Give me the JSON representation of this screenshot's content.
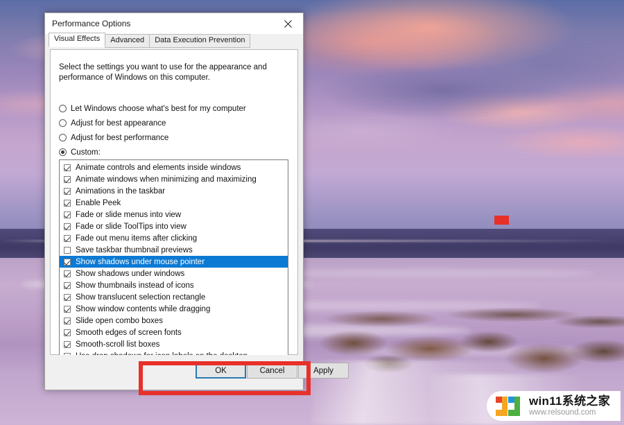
{
  "dialog": {
    "title": "Performance Options",
    "close_icon": "close-icon",
    "tabs": [
      {
        "label": "Visual Effects",
        "active": true
      },
      {
        "label": "Advanced",
        "active": false
      },
      {
        "label": "Data Execution Prevention",
        "active": false
      }
    ],
    "description": "Select the settings you want to use for the appearance and performance of Windows on this computer.",
    "radio_options": [
      {
        "label": "Let Windows choose what's best for my computer",
        "selected": false
      },
      {
        "label": "Adjust for best appearance",
        "selected": false
      },
      {
        "label": "Adjust for best performance",
        "selected": false
      },
      {
        "label": "Custom:",
        "selected": true
      }
    ],
    "checkbox_items": [
      {
        "label": "Animate controls and elements inside windows",
        "checked": true,
        "selected": false
      },
      {
        "label": "Animate windows when minimizing and maximizing",
        "checked": true,
        "selected": false
      },
      {
        "label": "Animations in the taskbar",
        "checked": true,
        "selected": false
      },
      {
        "label": "Enable Peek",
        "checked": true,
        "selected": false
      },
      {
        "label": "Fade or slide menus into view",
        "checked": true,
        "selected": false
      },
      {
        "label": "Fade or slide ToolTips into view",
        "checked": true,
        "selected": false
      },
      {
        "label": "Fade out menu items after clicking",
        "checked": true,
        "selected": false
      },
      {
        "label": "Save taskbar thumbnail previews",
        "checked": false,
        "selected": false
      },
      {
        "label": "Show shadows under mouse pointer",
        "checked": true,
        "selected": true
      },
      {
        "label": "Show shadows under windows",
        "checked": true,
        "selected": false
      },
      {
        "label": "Show thumbnails instead of icons",
        "checked": true,
        "selected": false
      },
      {
        "label": "Show translucent selection rectangle",
        "checked": true,
        "selected": false
      },
      {
        "label": "Show window contents while dragging",
        "checked": true,
        "selected": false
      },
      {
        "label": "Slide open combo boxes",
        "checked": true,
        "selected": false
      },
      {
        "label": "Smooth edges of screen fonts",
        "checked": true,
        "selected": false
      },
      {
        "label": "Smooth-scroll list boxes",
        "checked": true,
        "selected": false
      },
      {
        "label": "Use drop shadows for icon labels on the desktop",
        "checked": true,
        "selected": false
      }
    ],
    "buttons": {
      "ok": "OK",
      "cancel": "Cancel",
      "apply": "Apply"
    }
  },
  "annotations": {
    "highlight_color": "#e8302a",
    "selection_color": "#0b7ad4"
  },
  "watermark": {
    "title": "win11系统之家",
    "url": "www.relsound.com",
    "logo_colors": [
      "#e8432a",
      "#f5a623",
      "#2196d8",
      "#4caf3f"
    ]
  }
}
